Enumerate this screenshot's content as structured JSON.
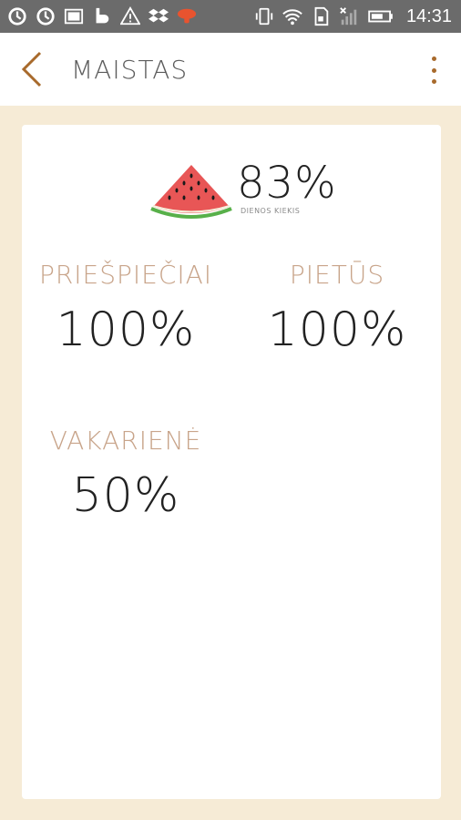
{
  "status_bar": {
    "time": "14:31",
    "icons": [
      "sync-icon",
      "sync-icon",
      "image-icon",
      "b-app-icon",
      "warning-icon",
      "dropbox-icon",
      "mushroom-app-icon",
      "vibrate-icon",
      "wifi-icon",
      "sd-card-icon",
      "no-signal-icon",
      "battery-icon"
    ]
  },
  "app_bar": {
    "title": "MAISTAS",
    "back_icon": "chevron-left-icon",
    "menu_icon": "more-vertical-icon"
  },
  "summary": {
    "icon": "watermelon-icon",
    "value": "83%",
    "label": "DIENOS KIEKIS"
  },
  "meals": [
    {
      "title": "PRIEŠPIEČIAI",
      "value": "100%"
    },
    {
      "title": "PIETŪS",
      "value": "100%"
    },
    {
      "title": "VAKARIENĖ",
      "value": "50%"
    }
  ],
  "colors": {
    "accent": "#a86a2c",
    "meal_title": "#c8a48a",
    "background": "#f6ebd6",
    "status_bar": "#6b6b6b"
  }
}
